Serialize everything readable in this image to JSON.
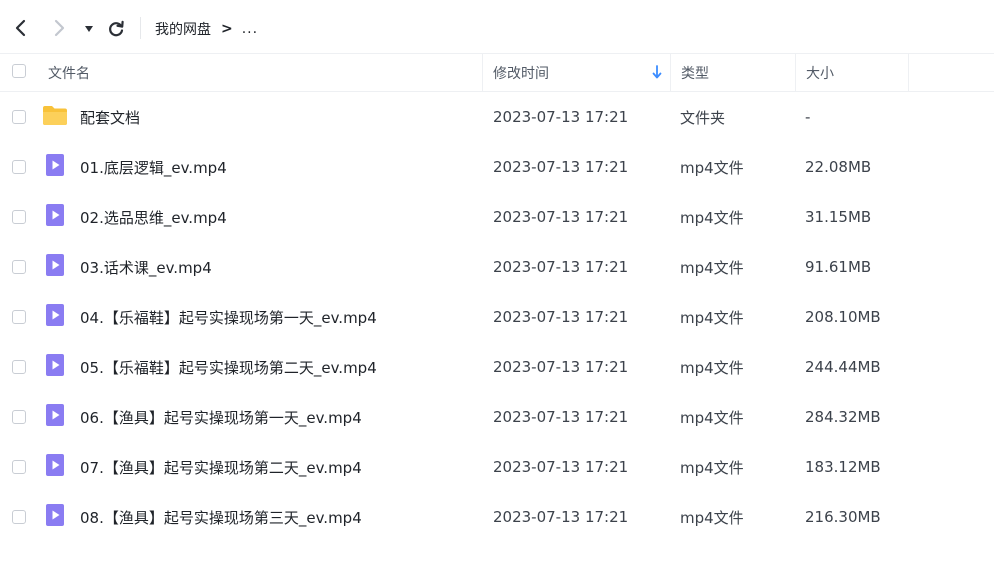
{
  "toolbar": {
    "back_icon": "chevron-left-icon",
    "forward_icon": "chevron-right-icon",
    "dropdown_icon": "caret-down-icon",
    "refresh_icon": "refresh-icon",
    "breadcrumb_root": "我的网盘",
    "breadcrumb_sep": ">",
    "breadcrumb_more": "..."
  },
  "columns": {
    "name": "文件名",
    "time": "修改时间",
    "type": "类型",
    "size": "大小",
    "sort_icon": "arrow-down-icon"
  },
  "colors": {
    "folder": "#f8c23a",
    "video": "#8a7cf2",
    "sort_arrow": "#3b8cff"
  },
  "files": [
    {
      "icon": "folder-icon",
      "name": "配套文档",
      "time": "2023-07-13 17:21",
      "type": "文件夹",
      "size": "-"
    },
    {
      "icon": "video-file-icon",
      "name": "01.底层逻辑_ev.mp4",
      "time": "2023-07-13 17:21",
      "type": "mp4文件",
      "size": "22.08MB"
    },
    {
      "icon": "video-file-icon",
      "name": "02.选品思维_ev.mp4",
      "time": "2023-07-13 17:21",
      "type": "mp4文件",
      "size": "31.15MB"
    },
    {
      "icon": "video-file-icon",
      "name": "03.话术课_ev.mp4",
      "time": "2023-07-13 17:21",
      "type": "mp4文件",
      "size": "91.61MB"
    },
    {
      "icon": "video-file-icon",
      "name": "04.【乐福鞋】起号实操现场第一天_ev.mp4",
      "time": "2023-07-13 17:21",
      "type": "mp4文件",
      "size": "208.10MB"
    },
    {
      "icon": "video-file-icon",
      "name": "05.【乐福鞋】起号实操现场第二天_ev.mp4",
      "time": "2023-07-13 17:21",
      "type": "mp4文件",
      "size": "244.44MB"
    },
    {
      "icon": "video-file-icon",
      "name": "06.【渔具】起号实操现场第一天_ev.mp4",
      "time": "2023-07-13 17:21",
      "type": "mp4文件",
      "size": "284.32MB"
    },
    {
      "icon": "video-file-icon",
      "name": "07.【渔具】起号实操现场第二天_ev.mp4",
      "time": "2023-07-13 17:21",
      "type": "mp4文件",
      "size": "183.12MB"
    },
    {
      "icon": "video-file-icon",
      "name": "08.【渔具】起号实操现场第三天_ev.mp4",
      "time": "2023-07-13 17:21",
      "type": "mp4文件",
      "size": "216.30MB"
    }
  ]
}
